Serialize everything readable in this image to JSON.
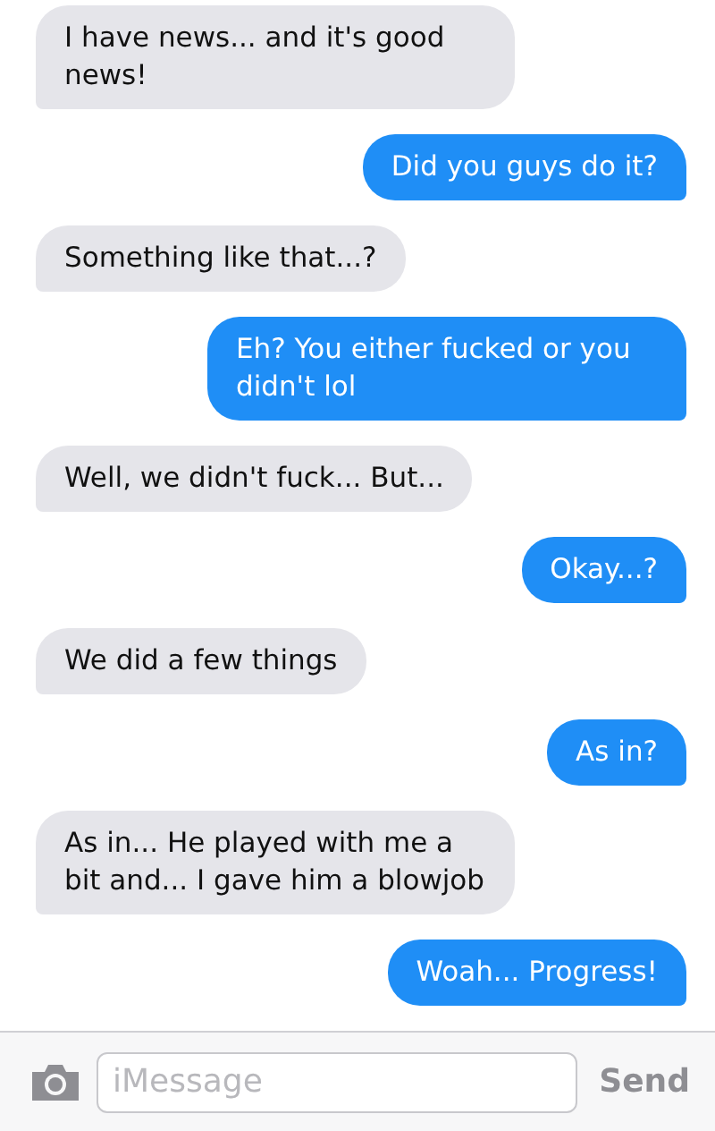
{
  "messages": [
    {
      "kind": "incoming",
      "text": "I have news... and it's good news!"
    },
    {
      "kind": "outgoing",
      "text": "Did you guys do it?"
    },
    {
      "kind": "incoming",
      "text": "Something like that...?"
    },
    {
      "kind": "outgoing",
      "text": "Eh? You either fucked or you didn't lol"
    },
    {
      "kind": "incoming",
      "text": "Well, we didn't fuck... But..."
    },
    {
      "kind": "outgoing",
      "text": "Okay...?"
    },
    {
      "kind": "incoming",
      "text": "We did a few things"
    },
    {
      "kind": "outgoing",
      "text": "As in?"
    },
    {
      "kind": "incoming",
      "text": "As in... He played with me a bit and... I gave him a blowjob"
    },
    {
      "kind": "outgoing",
      "text": "Woah... Progress!"
    }
  ],
  "compose": {
    "placeholder": "iMessage",
    "send": "Send"
  }
}
